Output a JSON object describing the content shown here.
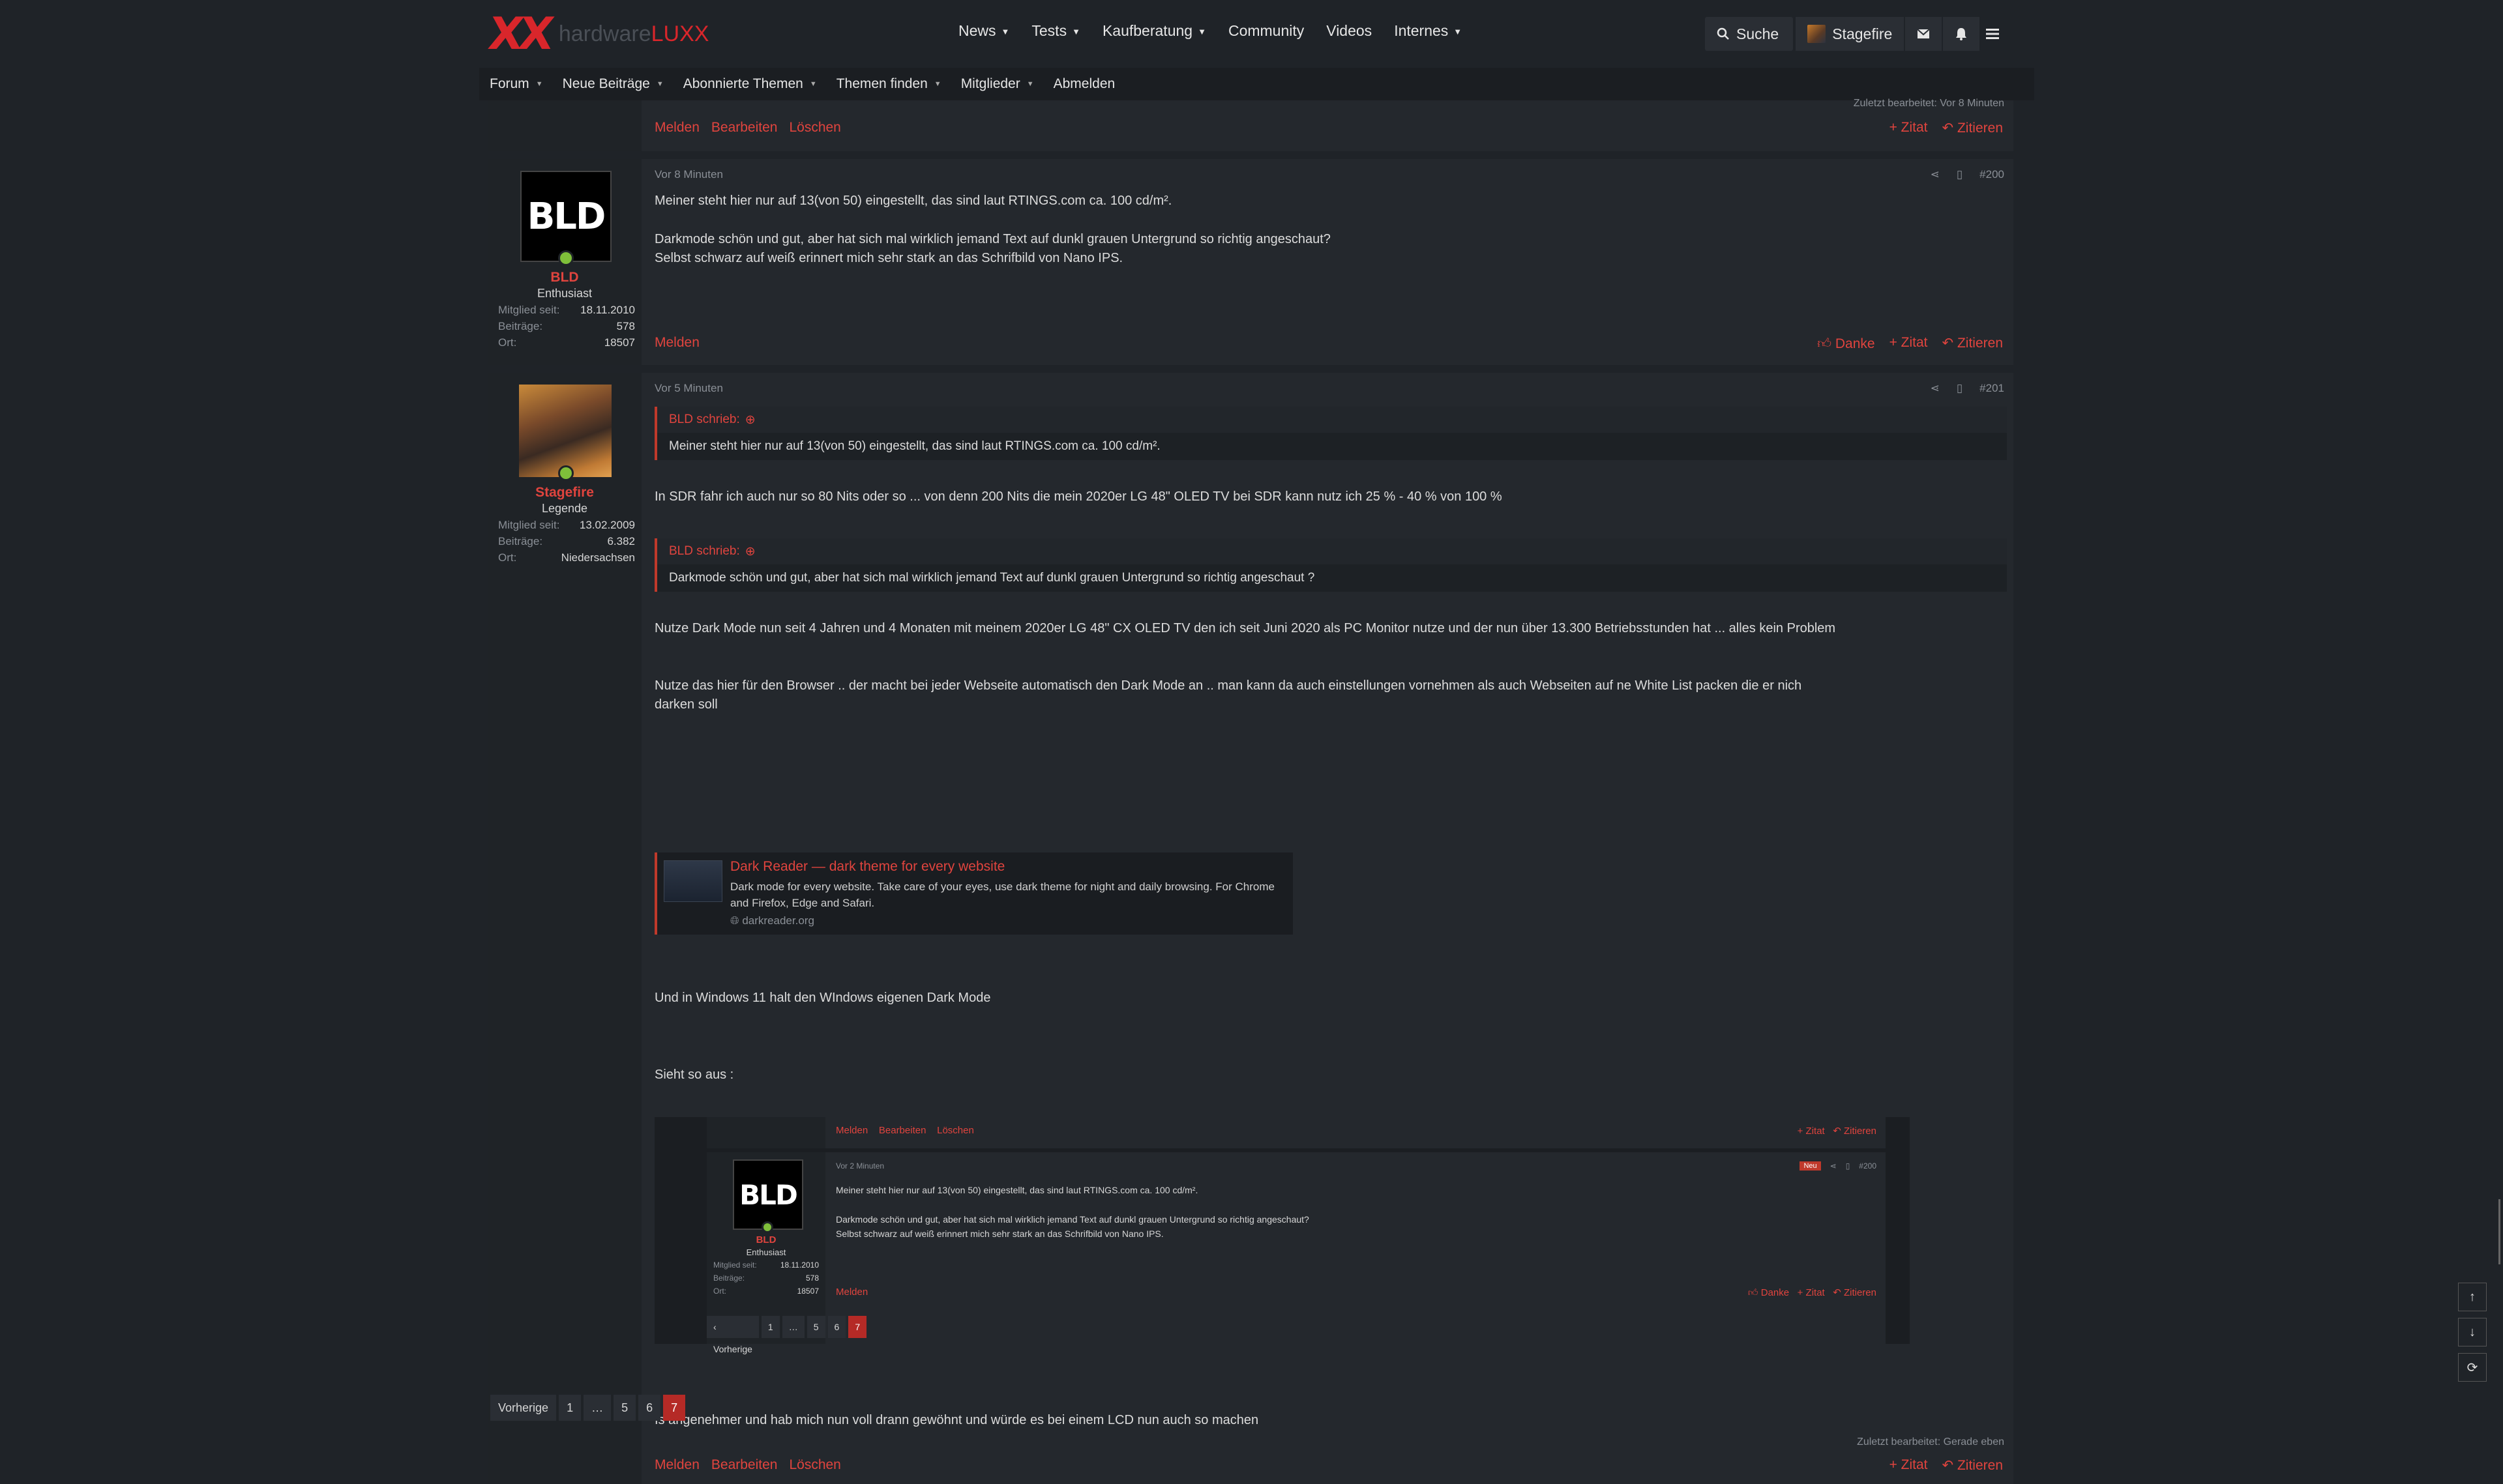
{
  "header": {
    "logo_mark": "XX",
    "brand_a": "hardware",
    "brand_b": "LUXX",
    "nav": [
      {
        "label": "News",
        "dropdown": true
      },
      {
        "label": "Tests",
        "dropdown": true
      },
      {
        "label": "Kaufberatung",
        "dropdown": true
      },
      {
        "label": "Community",
        "dropdown": false
      },
      {
        "label": "Videos",
        "dropdown": false
      },
      {
        "label": "Internes",
        "dropdown": true
      }
    ],
    "search_label": "Suche",
    "user_label": "Stagefire"
  },
  "subnav": [
    "Forum",
    "Neue Beiträge",
    "Abonnierte Themen",
    "Themen finden",
    "Mitglieder",
    "Abmelden"
  ],
  "prev_post": {
    "edited": "Zuletzt bearbeitet: Vor 8 Minuten",
    "left_actions": [
      "Melden",
      "Bearbeiten",
      "Löschen"
    ],
    "zitat": "+ Zitat",
    "zitieren": "Zitieren"
  },
  "post200": {
    "time": "Vor 8 Minuten",
    "number": "#200",
    "user": {
      "name": "BLD",
      "title": "Enthusiast",
      "avatar_text": "BLD",
      "stats": [
        [
          "Mitglied seit:",
          "18.11.2010"
        ],
        [
          "Beiträge:",
          "578"
        ],
        [
          "Ort:",
          "18507"
        ]
      ]
    },
    "lines": [
      "Meiner steht hier nur auf 13(von 50) eingestellt, das sind laut RTINGS.com ca. 100 cd/m².",
      "Darkmode schön und gut, aber hat sich mal wirklich jemand Text auf dunkl grauen Untergrund so richtig angeschaut?",
      "Selbst schwarz auf weiß erinnert mich sehr stark an das Schrifbild von Nano IPS."
    ],
    "melden": "Melden",
    "danke": "Danke",
    "zitat": "+ Zitat",
    "zitieren": "Zitieren"
  },
  "post201": {
    "time": "Vor 5 Minuten",
    "number": "#201",
    "user": {
      "name": "Stagefire",
      "title": "Legende",
      "stats": [
        [
          "Mitglied seit:",
          "13.02.2009"
        ],
        [
          "Beiträge:",
          "6.382"
        ],
        [
          "Ort:",
          "Niedersachsen"
        ]
      ]
    },
    "quote1_head": "BLD schrieb:",
    "quote1_body": "Meiner steht hier nur auf 13(von 50) eingestellt, das sind laut RTINGS.com ca. 100 cd/m².",
    "text1": "In SDR fahr ich auch nur so 80 Nits oder so ... von denn 200 Nits die mein 2020er LG 48\" OLED TV bei SDR kann nutz ich 25 % - 40 % von 100 %",
    "quote2_head": "BLD schrieb:",
    "quote2_body": "Darkmode schön und gut, aber hat sich mal wirklich jemand Text auf dunkl grauen Untergrund so richtig angeschaut ?",
    "text2": "Nutze Dark Mode nun seit 4 Jahren und 4 Monaten mit meinem 2020er LG 48\" CX OLED TV den ich seit Juni 2020 als PC Monitor nutze und der nun über 13.300 Betriebsstunden hat ... alles kein Problem",
    "text3a": "Nutze das hier für den Browser .. der macht bei jeder Webseite automatisch den Dark Mode an .. man kann da auch einstellungen vornehmen als auch Webseiten auf ne White List packen die er nich",
    "text3b": "darken soll",
    "card": {
      "title": "Dark Reader — dark theme for every website",
      "desc": "Dark mode for every website. Take care of your eyes, use dark theme for night and daily browsing. For Chrome and Firefox, Edge and Safari.",
      "domain": "darkreader.org"
    },
    "text4": "Und in Windows 11 halt den WIndows eigenen Dark Mode",
    "text5": "Sieht so aus :",
    "text6": "Is angenehmer und hab mich nun voll drann gewöhnt und würde es bei einem LCD nun auch so machen",
    "edited": "Zuletzt bearbeitet: Gerade eben",
    "left_actions": [
      "Melden",
      "Bearbeiten",
      "Löschen"
    ],
    "zitat": "+ Zitat",
    "zitieren": "Zitieren"
  },
  "shot": {
    "top_actions": [
      "Melden",
      "Bearbeiten",
      "Löschen"
    ],
    "zitat": "+ Zitat",
    "zitieren": "Zitieren",
    "time": "Vor 2 Minuten",
    "neu": "Neu",
    "number": "#200",
    "name": "BLD",
    "title": "Enthusiast",
    "avatar_text": "BLD",
    "stats": [
      [
        "Mitglied seit:",
        "18.11.2010"
      ],
      [
        "Beiträge:",
        "578"
      ],
      [
        "Ort:",
        "18507"
      ]
    ],
    "lines": [
      "Meiner steht hier nur auf 13(von 50) eingestellt, das sind laut RTINGS.com ca. 100 cd/m².",
      "Darkmode schön und gut, aber hat sich mal wirklich jemand Text auf dunkl grauen Untergrund so richtig angeschaut?",
      "Selbst schwarz auf weiß erinnert mich sehr stark an das Schrifbild von Nano IPS."
    ],
    "melden": "Melden",
    "danke": "Danke",
    "pages": [
      "‹ Vorherige",
      "1",
      "…",
      "5",
      "6",
      "7"
    ]
  },
  "bottom_pages": [
    "Vorherige",
    "1",
    "…",
    "5",
    "6",
    "7"
  ]
}
